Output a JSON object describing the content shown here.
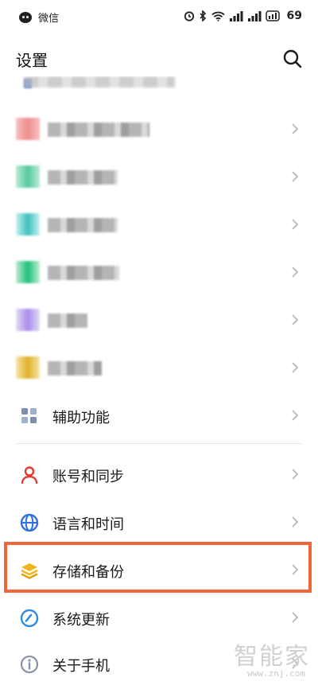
{
  "status_bar": {
    "app_name": "微信",
    "battery": "69"
  },
  "header": {
    "title": "设置"
  },
  "blurred_rows_count": 6,
  "settings": [
    {
      "id": "accessibility",
      "label": "辅助功能",
      "icon": "accessibility-grid-icon",
      "color": "#7c8fb0"
    },
    {
      "id": "account-sync",
      "label": "账号和同步",
      "icon": "person-icon",
      "color": "#e23b2f"
    },
    {
      "id": "language-time",
      "label": "语言和时间",
      "icon": "globe-icon",
      "color": "#2f6fe0"
    },
    {
      "id": "storage-backup",
      "label": "存储和备份",
      "icon": "layers-icon",
      "color": "#f2b51b",
      "highlighted": true
    },
    {
      "id": "system-update",
      "label": "系统更新",
      "icon": "update-circle-icon",
      "color": "#2f8ae0"
    },
    {
      "id": "about-phone",
      "label": "关于手机",
      "icon": "info-icon",
      "color": "#8a93a6"
    }
  ],
  "highlight_color": "#f0663a",
  "watermark": {
    "title": "智能家",
    "url": "www.znj.com"
  }
}
